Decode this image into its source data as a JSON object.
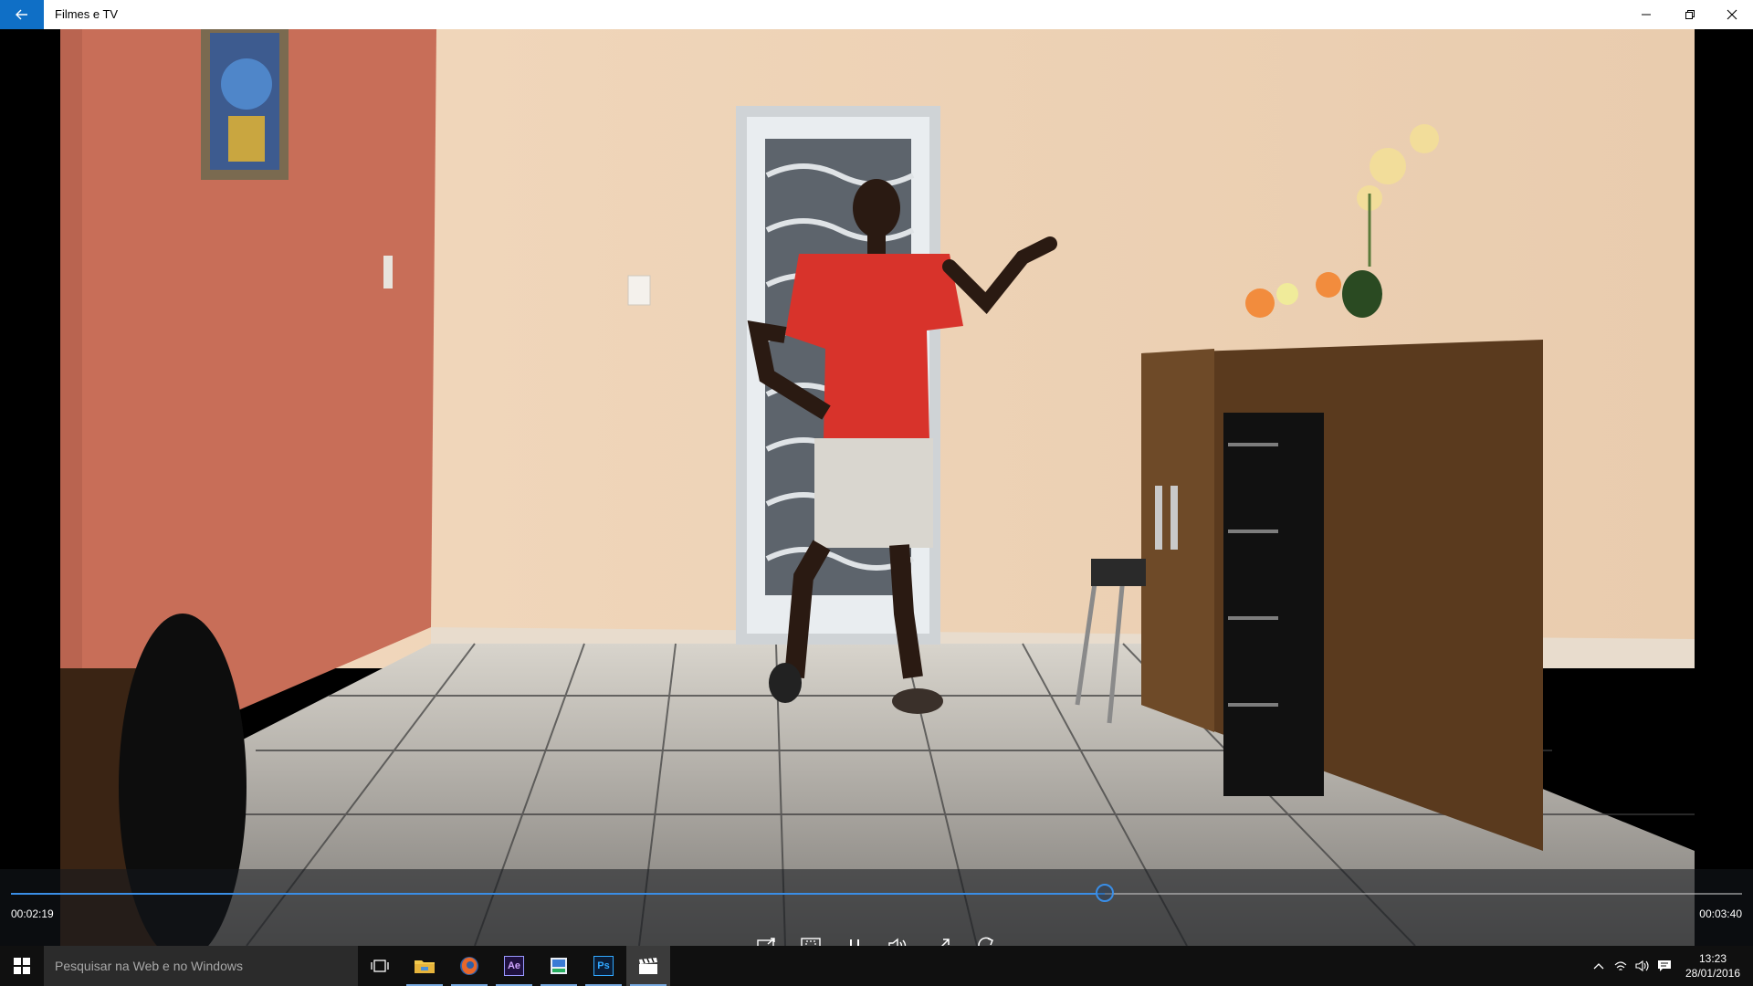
{
  "window": {
    "title": "Filmes e TV"
  },
  "player": {
    "elapsed": "00:02:19",
    "total": "00:03:40",
    "progress_fraction": 0.632
  },
  "taskbar": {
    "search_placeholder": "Pesquisar na Web e no Windows",
    "apps": [
      "task-view",
      "file-explorer",
      "firefox",
      "after-effects",
      "media-app",
      "photoshop",
      "filmes-e-tv"
    ],
    "ae_label": "Ae",
    "ps_label": "Ps",
    "clock_time": "13:23",
    "clock_date": "28/01/2016"
  },
  "colors": {
    "accent": "#0f6fc6",
    "seek": "#3a8ee6"
  }
}
